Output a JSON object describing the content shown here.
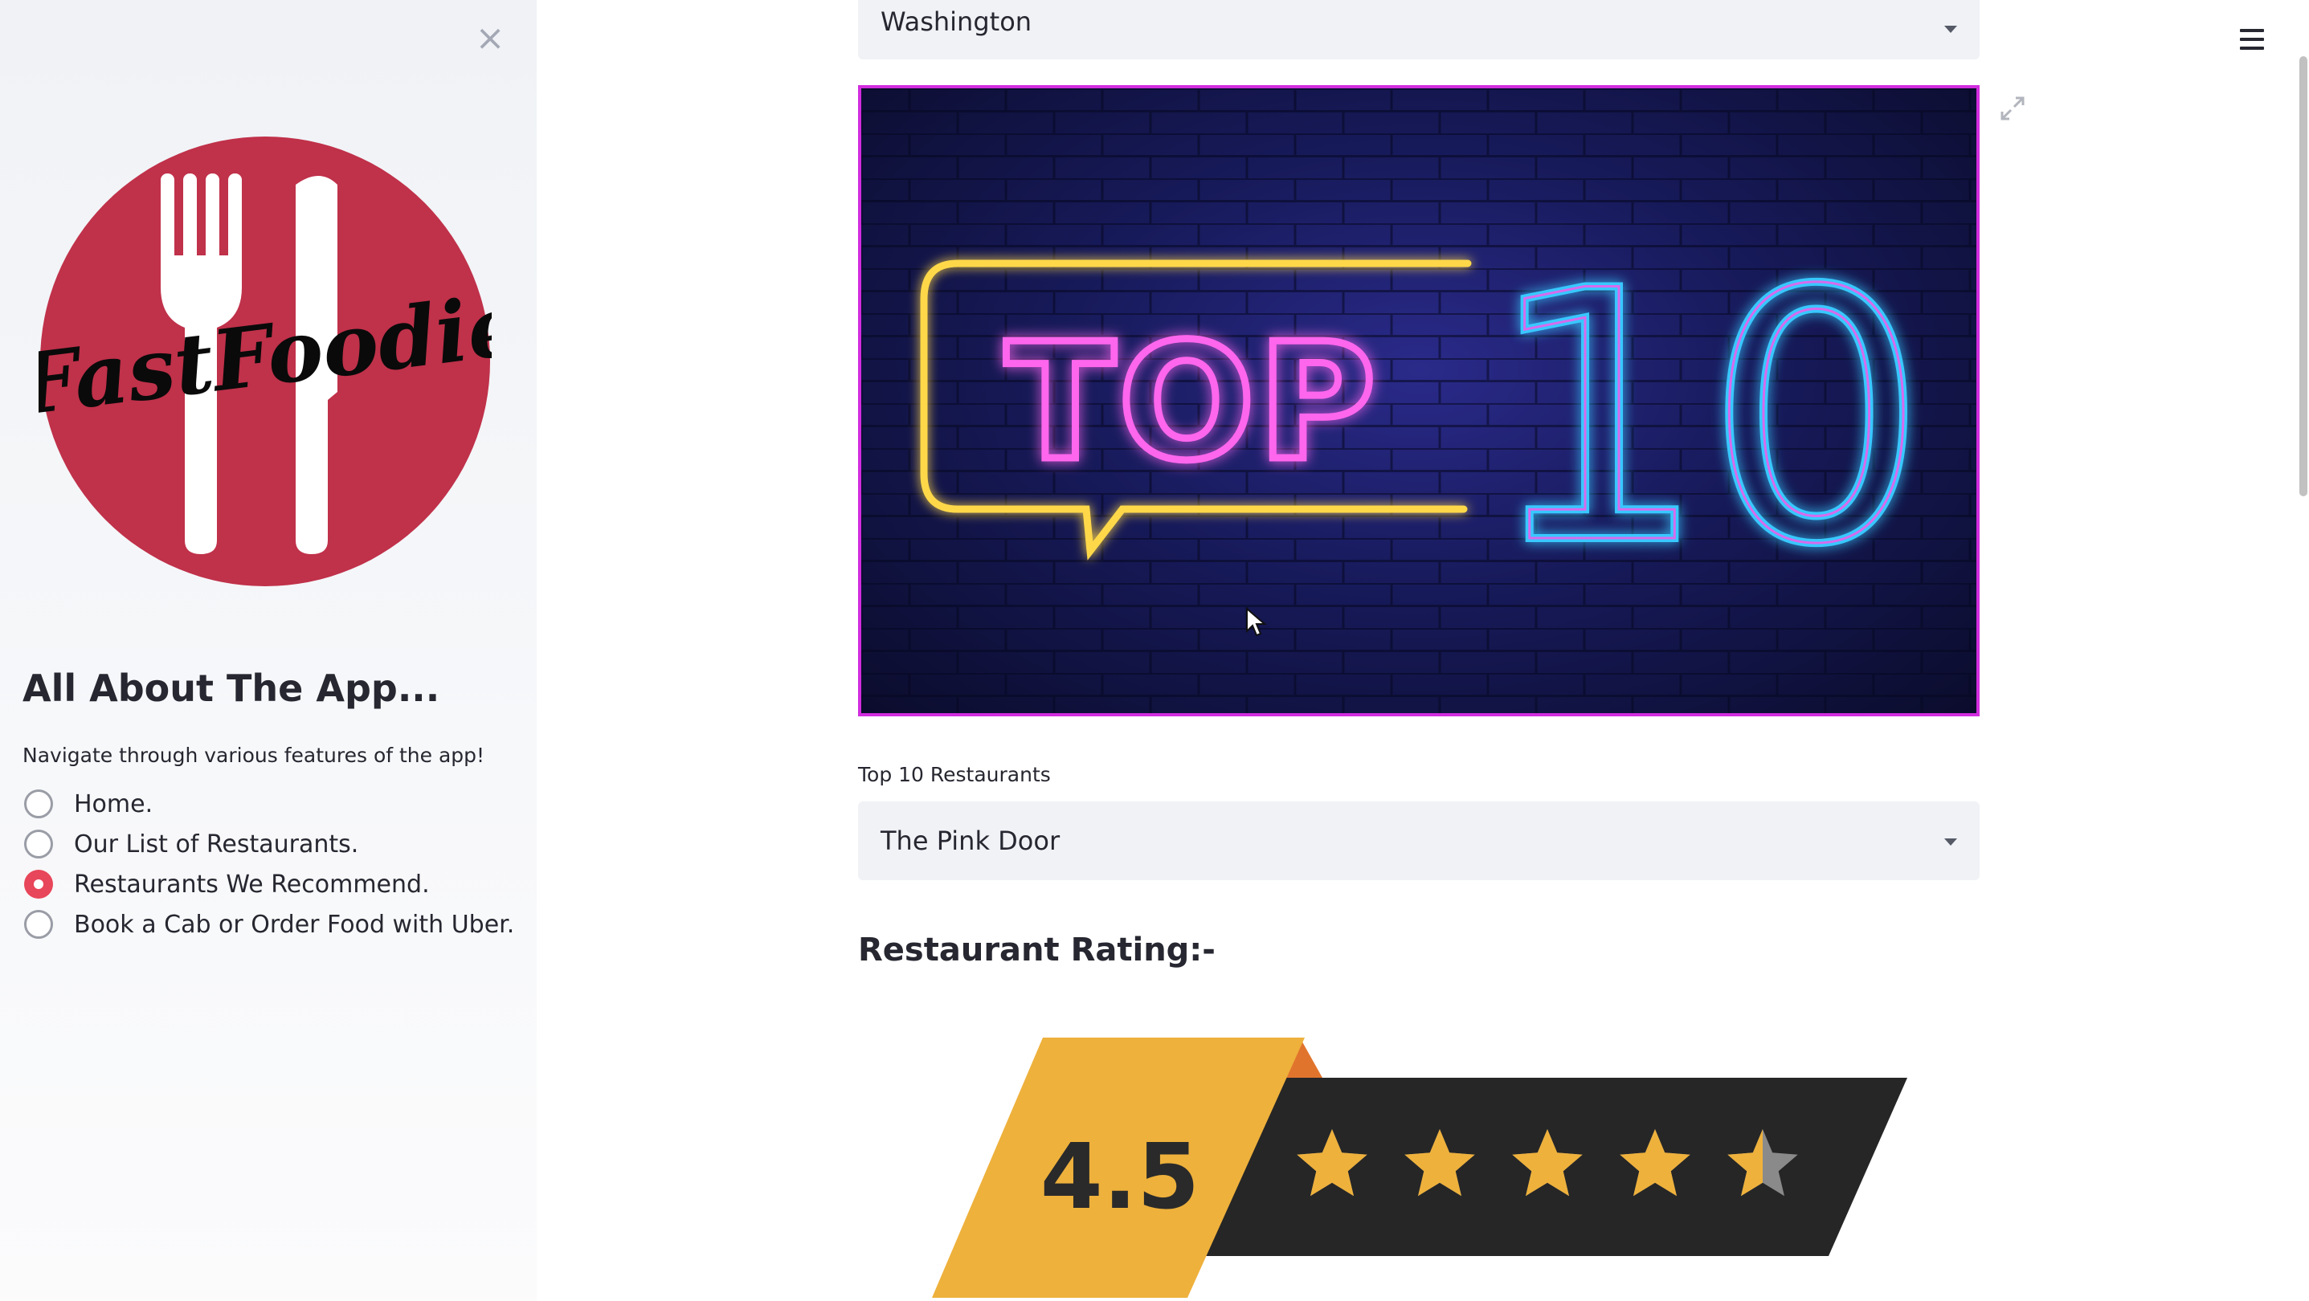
{
  "sidebar": {
    "logo_text": "FastFoodie",
    "title": "All About The App...",
    "subtitle": "Navigate through various features of the app!",
    "nav": [
      {
        "label": "Home.",
        "selected": false
      },
      {
        "label": "Our List of Restaurants.",
        "selected": false
      },
      {
        "label": "Restaurants We Recommend.",
        "selected": true
      },
      {
        "label": "Book a Cab or Order Food with Uber.",
        "selected": false
      }
    ]
  },
  "main": {
    "city_select": {
      "value": "Washington"
    },
    "hero": {
      "word": "TOP",
      "number": "10"
    },
    "restaurant_select": {
      "label": "Top 10 Restaurants",
      "value": "The Pink Door"
    },
    "rating": {
      "heading": "Restaurant Rating:-",
      "value": "4.5",
      "stars": 4.5,
      "max_stars": 5
    }
  },
  "colors": {
    "accent": "#e8465a",
    "logo_red": "#c0314a",
    "select_bg": "#f0f2f6",
    "hero_border": "#d22ddf",
    "rating_yellow": "#eeb13c",
    "rating_dark": "#262626"
  },
  "icons": {
    "close": "close-icon",
    "menu": "hamburger-menu-icon",
    "expand": "expand-icon",
    "dropdown": "chevron-down-icon"
  }
}
